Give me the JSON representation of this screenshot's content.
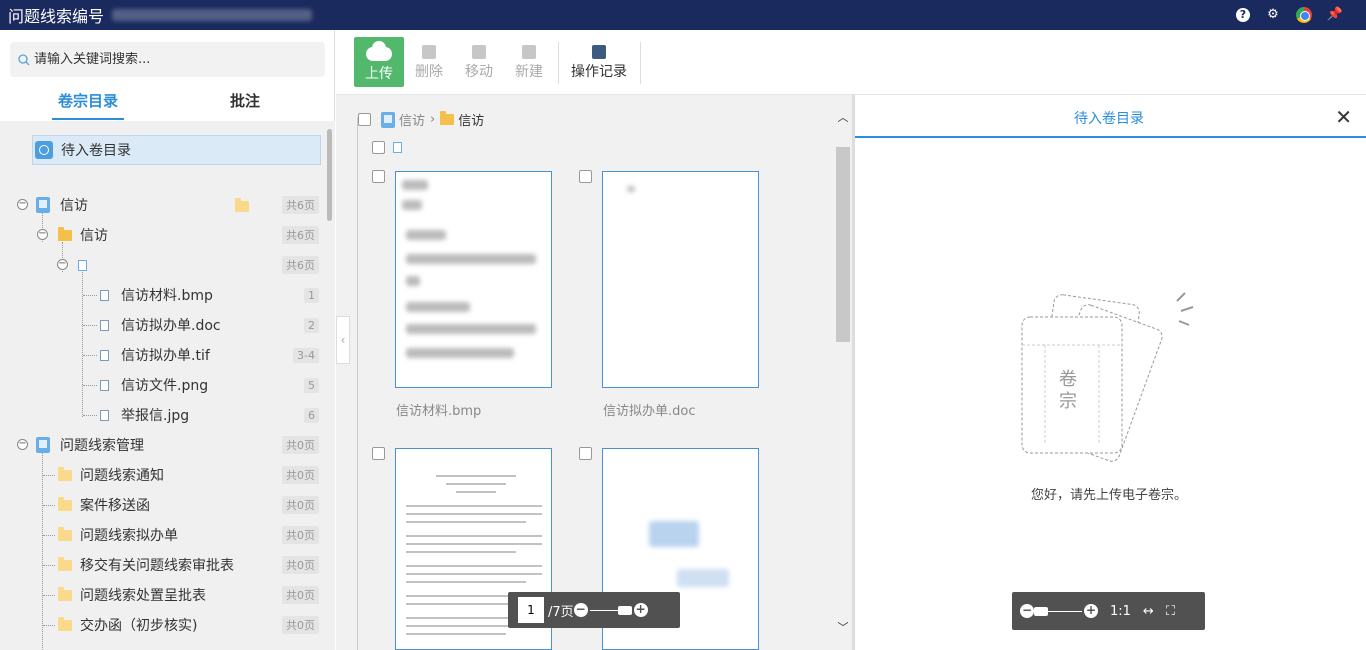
{
  "window": {
    "title": "问题线索编号"
  },
  "titlebar_icons": [
    "help-icon",
    "gear-icon",
    "chrome-icon",
    "pin-icon"
  ],
  "search": {
    "placeholder": "请输入关键词搜索..."
  },
  "left_tabs": [
    {
      "label": "卷宗目录",
      "active": true
    },
    {
      "label": "批注",
      "active": false
    }
  ],
  "tree": {
    "pending": "待入卷目录",
    "nodes": [
      {
        "label": "信访",
        "count": "共6页"
      },
      {
        "label": "信访",
        "count": "共6页"
      },
      {
        "label": "",
        "count": "共6页"
      },
      {
        "label": "信访材料.bmp",
        "count": "1"
      },
      {
        "label": "信访拟办单.doc",
        "count": "2"
      },
      {
        "label": "信访拟办单.tif",
        "count": "3-4"
      },
      {
        "label": "信访文件.png",
        "count": "5"
      },
      {
        "label": "举报信.jpg",
        "count": "6"
      },
      {
        "label": "问题线索管理",
        "count": "共0页"
      },
      {
        "label": "问题线索通知",
        "count": "共0页"
      },
      {
        "label": "案件移送函",
        "count": "共0页"
      },
      {
        "label": "问题线索拟办单",
        "count": "共0页"
      },
      {
        "label": "移交有关问题线索审批表",
        "count": "共0页"
      },
      {
        "label": "问题线索处置呈批表",
        "count": "共0页"
      },
      {
        "label": "交办函（初步核实)",
        "count": "共0页"
      }
    ]
  },
  "toolbar": {
    "upload": "上传",
    "delete": "删除",
    "move": "移动",
    "new": "新建",
    "op_log": "操作记录"
  },
  "breadcrumb": {
    "root": "信访",
    "current": "信访"
  },
  "files": [
    {
      "name": "信访材料.bmp"
    },
    {
      "name": "信访拟办单.doc"
    }
  ],
  "pager": {
    "page": "1",
    "total": "/7页"
  },
  "right_panel": {
    "title": "待入卷目录",
    "illustration_text": "卷宗",
    "empty_message": "您好，请先上传电子卷宗。",
    "zoom_ratio": "1:1"
  }
}
